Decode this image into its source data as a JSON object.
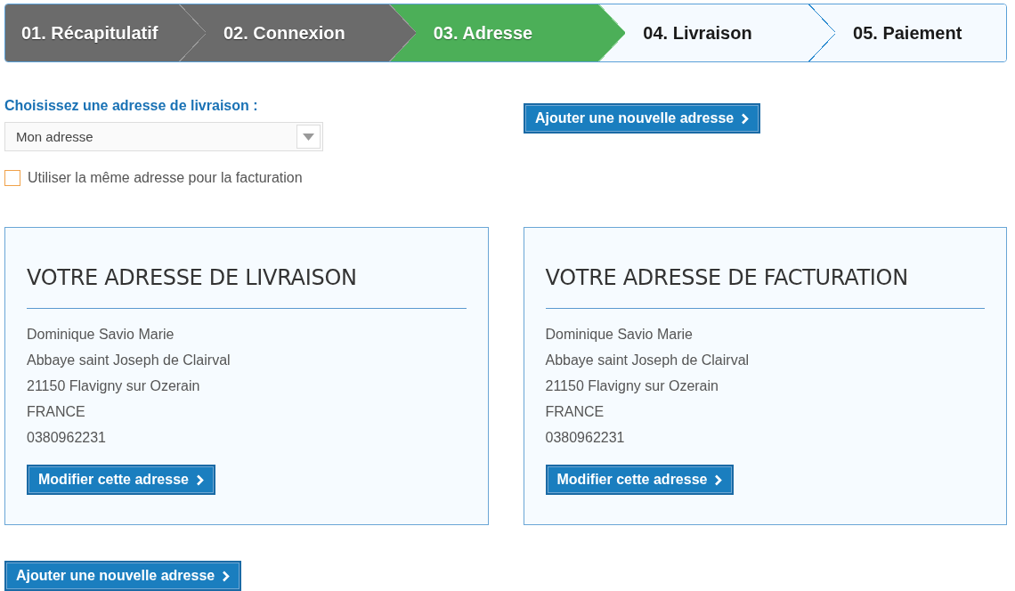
{
  "steps": [
    {
      "label": "01. Récapitulatif",
      "kind": "done"
    },
    {
      "label": "02. Connexion",
      "kind": "done"
    },
    {
      "label": "03. Adresse",
      "kind": "current"
    },
    {
      "label": "04. Livraison",
      "kind": "upcoming"
    },
    {
      "label": "05. Paiement",
      "kind": "upcoming"
    }
  ],
  "delivery_select": {
    "label": "Choisissez une adresse de livraison :",
    "value": "Mon adresse"
  },
  "same_address": {
    "label": "Utiliser la même adresse pour la facturation",
    "checked": false
  },
  "add_address_top": "Ajouter une nouvelle adresse",
  "cards": [
    {
      "title": "VOTRE ADRESSE DE LIVRAISON",
      "lines": [
        "Dominique Savio Marie",
        "Abbaye saint Joseph de Clairval",
        "21150 Flavigny sur Ozerain",
        "FRANCE",
        "0380962231"
      ],
      "button": "Modifier cette adresse"
    },
    {
      "title": "VOTRE ADRESSE DE FACTURATION",
      "lines": [
        "Dominique Savio Marie",
        "Abbaye saint Joseph de Clairval",
        "21150 Flavigny sur Ozerain",
        "FRANCE",
        "0380962231"
      ],
      "button": "Modifier cette adresse"
    }
  ],
  "add_address_bottom": "Ajouter une nouvelle adresse"
}
